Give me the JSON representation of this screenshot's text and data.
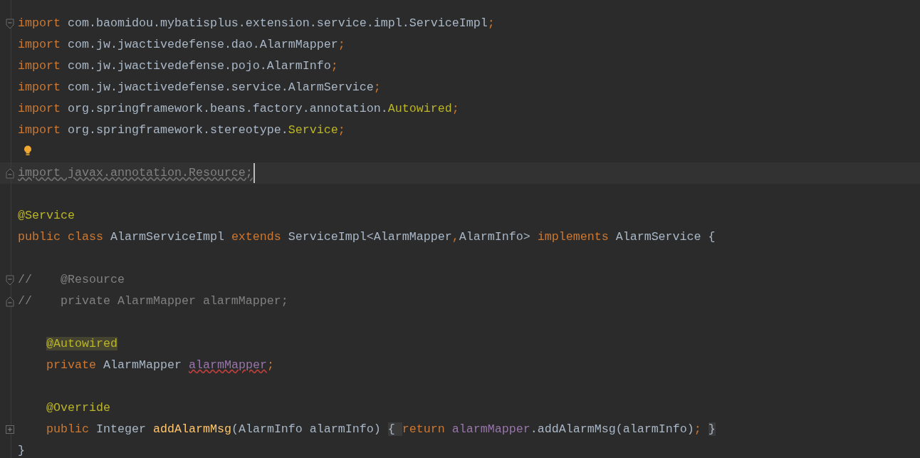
{
  "editor": {
    "blocks": [
      {
        "lines": [
          {
            "fold_marker": {
              "kind": "start"
            },
            "tokens": [
              {
                "text": "import",
                "kind": "keyword"
              },
              {
                "text": " com.baomidou.mybatisplus.extension.service.impl.ServiceImpl",
                "kind": "plain"
              },
              {
                "text": ";",
                "kind": "keyword"
              }
            ]
          },
          {
            "tokens": [
              {
                "text": "import",
                "kind": "keyword"
              },
              {
                "text": " com.jw.jwactivedefense.dao.AlarmMapper",
                "kind": "plain"
              },
              {
                "text": ";",
                "kind": "keyword"
              }
            ]
          },
          {
            "tokens": [
              {
                "text": "import",
                "kind": "keyword"
              },
              {
                "text": " com.jw.jwactivedefense.pojo.AlarmInfo",
                "kind": "plain"
              },
              {
                "text": ";",
                "kind": "keyword"
              }
            ]
          },
          {
            "tokens": [
              {
                "text": "import",
                "kind": "keyword"
              },
              {
                "text": " com.jw.jwactivedefense.service.AlarmService",
                "kind": "plain"
              },
              {
                "text": ";",
                "kind": "keyword"
              }
            ]
          },
          {
            "tokens": [
              {
                "text": "import",
                "kind": "keyword"
              },
              {
                "text": " org.springframework.beans.factory.annotation.",
                "kind": "plain"
              },
              {
                "text": "Autowired",
                "kind": "annotation"
              },
              {
                "text": ";",
                "kind": "keyword"
              }
            ]
          },
          {
            "tokens": [
              {
                "text": "import",
                "kind": "keyword"
              },
              {
                "text": " org.springframework.stereotype.",
                "kind": "plain"
              },
              {
                "text": "Service",
                "kind": "annotation"
              },
              {
                "text": ";",
                "kind": "keyword"
              }
            ]
          },
          {
            "bulb": true
          },
          {
            "fold_marker": {
              "kind": "end"
            },
            "current": true,
            "caret": true,
            "tokens": [
              {
                "text": "import javax.annotation.Resource;",
                "kind": "unused"
              }
            ]
          }
        ]
      },
      {
        "lines": [
          {
            "tokens": [
              {
                "text": "@Service",
                "kind": "annotation"
              }
            ]
          },
          {
            "tokens": [
              {
                "text": "public class",
                "kind": "keyword"
              },
              {
                "text": " AlarmServiceImpl ",
                "kind": "plain"
              },
              {
                "text": "extends",
                "kind": "keyword"
              },
              {
                "text": " ServiceImpl<AlarmMapper",
                "kind": "plain"
              },
              {
                "text": ",",
                "kind": "keyword"
              },
              {
                "text": "AlarmInfo> ",
                "kind": "plain"
              },
              {
                "text": "implements",
                "kind": "keyword"
              },
              {
                "text": " AlarmService {",
                "kind": "plain"
              }
            ]
          }
        ]
      },
      {
        "lines": [
          {
            "fold_marker": {
              "kind": "start"
            },
            "tokens": [
              {
                "text": "//    @Resource",
                "kind": "comment"
              }
            ]
          },
          {
            "fold_marker": {
              "kind": "end"
            },
            "tokens": [
              {
                "text": "//    private AlarmMapper alarmMapper;",
                "kind": "comment"
              }
            ]
          }
        ]
      },
      {
        "lines": [
          {
            "indented": true,
            "tokens": [
              {
                "text": "@Autowired",
                "kind": "usage-highlight"
              }
            ]
          },
          {
            "indented": true,
            "tokens": [
              {
                "text": "private",
                "kind": "keyword"
              },
              {
                "text": " AlarmMapper ",
                "kind": "plain"
              },
              {
                "text": "alarmMapper",
                "kind": "field-warning"
              },
              {
                "text": ";",
                "kind": "keyword"
              }
            ]
          }
        ]
      },
      {
        "lines": [
          {
            "indented": true,
            "tokens": [
              {
                "text": "@Override",
                "kind": "annotation"
              }
            ]
          },
          {
            "fold_marker": {
              "kind": "collapsed"
            },
            "indented": true,
            "tokens": [
              {
                "text": "public",
                "kind": "keyword"
              },
              {
                "text": " Integer ",
                "kind": "plain"
              },
              {
                "text": "addAlarmMsg",
                "kind": "method"
              },
              {
                "text": "(AlarmInfo alarmInfo) ",
                "kind": "plain"
              },
              {
                "text": "{ ",
                "kind": "folded-brace"
              },
              {
                "text": "return ",
                "kind": "keyword"
              },
              {
                "text": "alarmMapper",
                "kind": "field"
              },
              {
                "text": ".addAlarmMsg(alarmInfo)",
                "kind": "plain"
              },
              {
                "text": "; ",
                "kind": "keyword"
              },
              {
                "text": "}",
                "kind": "folded-brace"
              }
            ]
          },
          {
            "tokens": [
              {
                "text": "}",
                "kind": "plain"
              }
            ]
          }
        ]
      }
    ]
  }
}
